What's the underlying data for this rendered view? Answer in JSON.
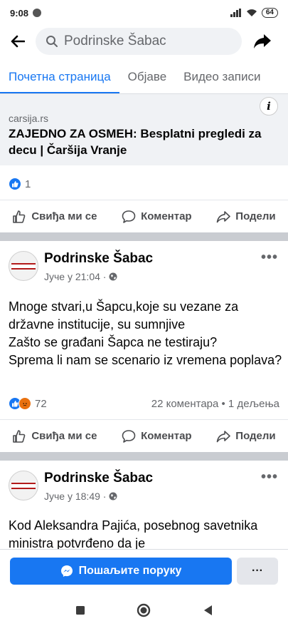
{
  "status_bar": {
    "time": "9:08",
    "battery": "64"
  },
  "search": {
    "query": "Podrinske Šabac"
  },
  "tabs": [
    {
      "label": "Почетна страница",
      "active": true
    },
    {
      "label": "Објаве",
      "active": false
    },
    {
      "label": "Видео записи",
      "active": false
    }
  ],
  "link_card": {
    "domain": "carsija.rs",
    "title": "ZAJEDNO ZA OSMEH: Besplatni pregledi za decu | Čaršija Vranje",
    "reactions_count": "1"
  },
  "actions": {
    "like": "Свиђа ми се",
    "comment": "Коментар",
    "share": "Подели"
  },
  "posts": [
    {
      "page_name": "Podrinske Šabac",
      "time": "Јуче у 21:04 ·",
      "text": "Mnoge stvari,u Šapcu,koje su vezane za državne institucije, su sumnjive\nZašto se građani Šapca ne testiraju?\nSprema li nam se scenario iz vremena poplava?",
      "reactions_count": "72",
      "stats": "22 коментара • 1 дељења"
    },
    {
      "page_name": "Podrinske Šabac",
      "time": "Јуче у 18:49 ·",
      "text": "Kod Aleksandra Pajića, posebnog savetnika ministra potvrđeno da je"
    }
  ],
  "message_bar": {
    "send_label": "Пошаљите поруку",
    "more_label": "···"
  },
  "colors": {
    "accent": "#1877f2",
    "divider": "#c9ccd1",
    "secondary_text": "#65676b"
  }
}
